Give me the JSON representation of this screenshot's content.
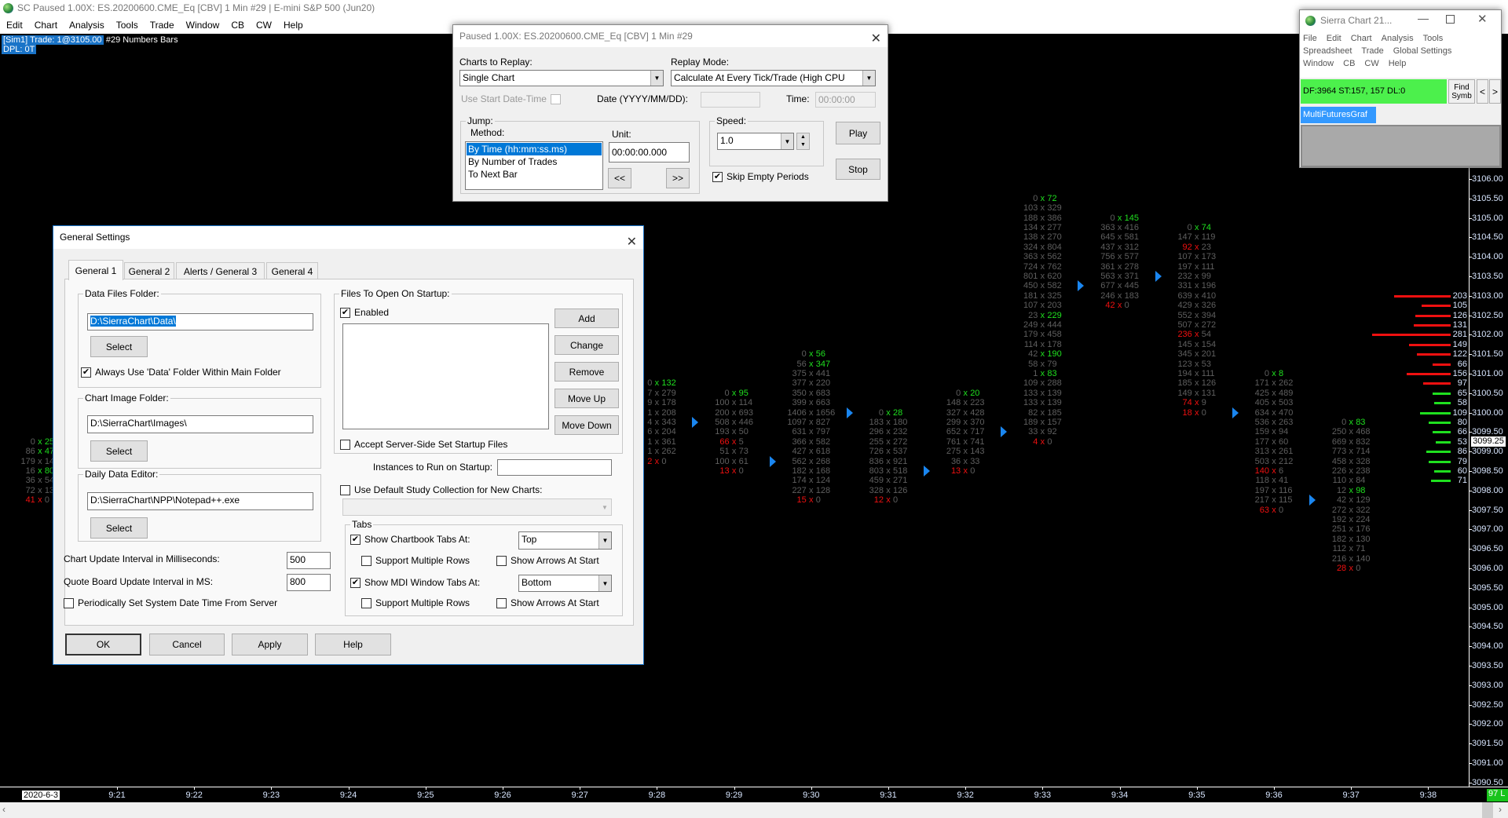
{
  "app": {
    "title": "SC Paused 1.00X: ES.20200600.CME_Eq [CBV]  1 Min   #29 | E-mini S&P 500 (Jun20)",
    "menu": [
      "Edit",
      "Chart",
      "Analysis",
      "Tools",
      "Trade",
      "Window",
      "CB",
      "CW",
      "Help"
    ]
  },
  "chart": {
    "trade_label": "[Sim1]  Trade: 1@3105.00",
    "study_label": "#29 Numbers Bars",
    "dpl_label": "DPL: 0T",
    "date_label": "2020-6-3",
    "last_label": "97 L",
    "current_price": "3099.25",
    "time_labels": [
      "9:21",
      "9:22",
      "9:23",
      "9:24",
      "9:25",
      "9:26",
      "9:27",
      "9:28",
      "9:29",
      "9:30",
      "9:31",
      "9:32",
      "9:33",
      "9:34",
      "9:35",
      "9:36",
      "9:37",
      "9:38"
    ],
    "price_labels": [
      "3106.00",
      "3105.50",
      "3105.00",
      "3104.50",
      "3104.00",
      "3103.50",
      "3103.00",
      "3102.50",
      "3102.00",
      "3101.50",
      "3101.00",
      "3100.50",
      "3100.00",
      "3099.50",
      "3099.00",
      "3098.50",
      "3098.00",
      "3097.50",
      "3097.00",
      "3096.50",
      "3096.00",
      "3095.50",
      "3095.00",
      "3094.50",
      "3094.00",
      "3093.50",
      "3093.00",
      "3092.50",
      "3092.00",
      "3091.50",
      "3091.00",
      "3090.50"
    ],
    "colors": {
      "bid_imbalance": "#f01010",
      "ask_imbalance": "#1fe01f",
      "neutral": "#5f5f5f",
      "marker": "#1a86f0"
    },
    "bars": [
      {
        "minute": 20,
        "high": 3099.25,
        "close": 3098.0,
        "rows": [
          [
            "0",
            "25",
            "a"
          ],
          [
            "86",
            "47",
            "a"
          ],
          [
            "179",
            "14",
            ""
          ],
          [
            "16",
            "80",
            "a"
          ],
          [
            "36",
            "54",
            ""
          ],
          [
            "72",
            "13",
            ""
          ],
          [
            "41",
            "0",
            "b"
          ]
        ]
      },
      {
        "minute": 28,
        "high": 3100.75,
        "close": 3099.75,
        "rows": [
          [
            "0",
            "132",
            "a"
          ],
          [
            "7",
            "279",
            ""
          ],
          [
            "9",
            "178",
            ""
          ],
          [
            "1",
            "208",
            ""
          ],
          [
            "4",
            "343",
            ""
          ],
          [
            "6",
            "204",
            ""
          ],
          [
            "1",
            "361",
            ""
          ],
          [
            "1",
            "262",
            ""
          ],
          [
            "2",
            "0",
            "b"
          ]
        ]
      },
      {
        "minute": 29,
        "high": 3100.5,
        "close": 3098.75,
        "rows": [
          [
            "0",
            "95",
            "a"
          ],
          [
            "100",
            "114",
            ""
          ],
          [
            "200",
            "693",
            ""
          ],
          [
            "508",
            "446",
            ""
          ],
          [
            "193",
            "50",
            ""
          ],
          [
            "66",
            "5",
            "b"
          ],
          [
            "51",
            "73",
            ""
          ],
          [
            "100",
            "61",
            ""
          ],
          [
            "13",
            "0",
            "b"
          ]
        ]
      },
      {
        "minute": 30,
        "high": 3101.5,
        "close": 3100.0,
        "rows": [
          [
            "0",
            "56",
            "a"
          ],
          [
            "56",
            "347",
            "a"
          ],
          [
            "375",
            "441",
            ""
          ],
          [
            "377",
            "220",
            ""
          ],
          [
            "350",
            "683",
            ""
          ],
          [
            "399",
            "663",
            ""
          ],
          [
            "1406",
            "1656",
            ""
          ],
          [
            "1097",
            "827",
            ""
          ],
          [
            "631",
            "797",
            ""
          ],
          [
            "366",
            "582",
            ""
          ],
          [
            "427",
            "618",
            ""
          ],
          [
            "562",
            "268",
            ""
          ],
          [
            "182",
            "168",
            ""
          ],
          [
            "174",
            "124",
            ""
          ],
          [
            "227",
            "128",
            ""
          ],
          [
            "15",
            "0",
            "b"
          ]
        ]
      },
      {
        "minute": 31,
        "high": 3100.0,
        "close": 3098.5,
        "rows": [
          [
            "0",
            "28",
            "a"
          ],
          [
            "183",
            "180",
            ""
          ],
          [
            "296",
            "232",
            ""
          ],
          [
            "255",
            "272",
            ""
          ],
          [
            "726",
            "537",
            ""
          ],
          [
            "836",
            "921",
            ""
          ],
          [
            "803",
            "518",
            ""
          ],
          [
            "459",
            "271",
            ""
          ],
          [
            "328",
            "126",
            ""
          ],
          [
            "12",
            "0",
            "b"
          ]
        ]
      },
      {
        "minute": 32,
        "high": 3100.5,
        "close": 3099.5,
        "rows": [
          [
            "0",
            "20",
            "a"
          ],
          [
            "148",
            "223",
            ""
          ],
          [
            "327",
            "428",
            ""
          ],
          [
            "299",
            "370",
            ""
          ],
          [
            "652",
            "717",
            ""
          ],
          [
            "761",
            "741",
            ""
          ],
          [
            "275",
            "143",
            ""
          ],
          [
            "36",
            "33",
            ""
          ],
          [
            "13",
            "0",
            "b"
          ]
        ]
      },
      {
        "minute": 33,
        "high": 3105.5,
        "close": 3103.25,
        "rows": [
          [
            "0",
            "72",
            "a"
          ],
          [
            "103",
            "329",
            ""
          ],
          [
            "188",
            "386",
            ""
          ],
          [
            "134",
            "277",
            ""
          ],
          [
            "138",
            "270",
            ""
          ],
          [
            "324",
            "804",
            ""
          ],
          [
            "363",
            "562",
            ""
          ],
          [
            "724",
            "762",
            ""
          ],
          [
            "801",
            "620",
            ""
          ],
          [
            "450",
            "582",
            ""
          ],
          [
            "181",
            "325",
            ""
          ],
          [
            "107",
            "203",
            ""
          ],
          [
            "23",
            "229",
            "a"
          ],
          [
            "249",
            "444",
            ""
          ],
          [
            "179",
            "458",
            ""
          ],
          [
            "114",
            "178",
            ""
          ],
          [
            "42",
            "190",
            "a"
          ],
          [
            "58",
            "79",
            ""
          ],
          [
            "1",
            "83",
            "a"
          ],
          [
            "109",
            "288",
            ""
          ],
          [
            "133",
            "139",
            ""
          ],
          [
            "133",
            "139",
            ""
          ],
          [
            "82",
            "185",
            ""
          ],
          [
            "189",
            "157",
            ""
          ],
          [
            "33",
            "92",
            ""
          ],
          [
            "4",
            "0",
            "b"
          ]
        ]
      },
      {
        "minute": 34,
        "high": 3105.0,
        "close": 3103.5,
        "rows": [
          [
            "0",
            "145",
            "a"
          ],
          [
            "363",
            "416",
            ""
          ],
          [
            "645",
            "581",
            ""
          ],
          [
            "437",
            "312",
            ""
          ],
          [
            "756",
            "577",
            ""
          ],
          [
            "361",
            "278",
            ""
          ],
          [
            "563",
            "371",
            ""
          ],
          [
            "677",
            "445",
            ""
          ],
          [
            "246",
            "183",
            ""
          ],
          [
            "42",
            "0",
            "b"
          ]
        ]
      },
      {
        "minute": 35,
        "high": 3104.75,
        "close": 3100.0,
        "rows": [
          [
            "0",
            "74",
            "a"
          ],
          [
            "147",
            "119",
            ""
          ],
          [
            "92",
            "23",
            "b"
          ],
          [
            "107",
            "173",
            ""
          ],
          [
            "197",
            "111",
            ""
          ],
          [
            "232",
            "99",
            ""
          ],
          [
            "331",
            "196",
            ""
          ],
          [
            "639",
            "410",
            ""
          ],
          [
            "429",
            "326",
            ""
          ],
          [
            "552",
            "394",
            ""
          ],
          [
            "507",
            "272",
            ""
          ],
          [
            "236",
            "54",
            "b"
          ],
          [
            "145",
            "154",
            ""
          ],
          [
            "345",
            "201",
            ""
          ],
          [
            "123",
            "53",
            ""
          ],
          [
            "194",
            "111",
            ""
          ],
          [
            "185",
            "126",
            ""
          ],
          [
            "149",
            "131",
            ""
          ],
          [
            "74",
            "9",
            "b"
          ],
          [
            "18",
            "0",
            "b"
          ]
        ]
      },
      {
        "minute": 36,
        "high": 3101.0,
        "close": 3097.75,
        "rows": [
          [
            "0",
            "8",
            "a"
          ],
          [
            "171",
            "262",
            ""
          ],
          [
            "425",
            "489",
            ""
          ],
          [
            "405",
            "503",
            ""
          ],
          [
            "634",
            "470",
            ""
          ],
          [
            "536",
            "263",
            ""
          ],
          [
            "159",
            "94",
            ""
          ],
          [
            "177",
            "60",
            ""
          ],
          [
            "313",
            "261",
            ""
          ],
          [
            "503",
            "212",
            ""
          ],
          [
            "140",
            "6",
            "b"
          ],
          [
            "118",
            "41",
            ""
          ],
          [
            "197",
            "116",
            ""
          ],
          [
            "217",
            "115",
            ""
          ],
          [
            "63",
            "0",
            "b"
          ]
        ]
      },
      {
        "minute": 37,
        "high": 3099.75,
        "close": null,
        "rows": [
          [
            "0",
            "83",
            "a"
          ],
          [
            "250",
            "468",
            ""
          ],
          [
            "669",
            "832",
            ""
          ],
          [
            "773",
            "714",
            ""
          ],
          [
            "458",
            "328",
            ""
          ],
          [
            "226",
            "238",
            ""
          ],
          [
            "110",
            "84",
            ""
          ],
          [
            "12",
            "98",
            "a"
          ],
          [
            "42",
            "129",
            ""
          ],
          [
            "272",
            "322",
            ""
          ],
          [
            "192",
            "224",
            ""
          ],
          [
            "251",
            "176",
            ""
          ],
          [
            "182",
            "130",
            ""
          ],
          [
            "112",
            "71",
            ""
          ],
          [
            "216",
            "140",
            ""
          ],
          [
            "28",
            "0",
            "b"
          ]
        ]
      }
    ],
    "volume_profile": {
      "top_price": 3103.0,
      "values": [
        "203",
        "105",
        "126",
        "131",
        "281",
        "149",
        "122",
        "66",
        "156",
        "97",
        "65",
        "58",
        "109",
        "80",
        "66",
        "53",
        "86",
        "79",
        "60",
        "71"
      ],
      "sides": [
        "sell",
        "sell",
        "sell",
        "sell",
        "sell",
        "sell",
        "sell",
        "sell",
        "sell",
        "sell",
        "buy",
        "buy",
        "buy",
        "buy",
        "buy",
        "buy",
        "buy",
        "buy",
        "buy",
        "buy"
      ]
    }
  },
  "replay": {
    "title": "Paused 1.00X: ES.20200600.CME_Eq [CBV]  1 Min   #29",
    "charts_label": "Charts to Replay:",
    "charts_value": "Single Chart",
    "mode_label": "Replay Mode:",
    "mode_value": "Calculate At Every Tick/Trade (High CPU",
    "use_start_label": "Use Start Date-Time",
    "date_label": "Date (YYYY/MM/DD):",
    "date_value": "",
    "time_label": "Time:",
    "time_value": "00:00:00",
    "jump_label": "Jump:",
    "method_label": "Method:",
    "methods": [
      "By Time (hh:mm:ss.ms)",
      "By Number of Trades",
      "To Next Bar"
    ],
    "unit_label": "Unit:",
    "unit_value": "00:00:00.000",
    "back_label": "<<",
    "fwd_label": ">>",
    "speed_label": "Speed:",
    "speed_value": "1.0",
    "skip_label": "Skip Empty Periods",
    "play_label": "Play",
    "stop_label": "Stop"
  },
  "general_settings": {
    "title": "General Settings",
    "tabs": [
      "General 1",
      "General 2",
      "Alerts / General 3",
      "General 4"
    ],
    "data_folder_label": "Data Files Folder:",
    "data_folder_value": "D:\\SierraChart\\Data\\",
    "select_label": "Select",
    "always_use_label": "Always Use 'Data' Folder Within Main Folder",
    "image_folder_label": "Chart Image Folder:",
    "image_folder_value": "D:\\SierraChart\\Images\\",
    "editor_label": "Daily Data Editor:",
    "editor_value": "D:\\SierraChart\\NPP\\Notepad++.exe",
    "chart_update_label": "Chart Update Interval in Milliseconds:",
    "chart_update_value": "500",
    "quote_update_label": "Quote Board Update Interval in MS:",
    "quote_update_value": "800",
    "periodic_label": "Periodically Set System Date Time From Server",
    "files_label": "Files To Open On Startup:",
    "enabled_label": "Enabled",
    "file_buttons": [
      "Add",
      "Change",
      "Remove",
      "Move Up",
      "Move Down"
    ],
    "accept_label": "Accept Server-Side Set Startup Files",
    "instances_label": "Instances to Run on Startup:",
    "instances_value": "",
    "default_study_label": "Use Default Study Collection for New Charts:",
    "tabs_group_label": "Tabs",
    "chartbook_tabs_label": "Show Chartbook Tabs At:",
    "chartbook_tabs_value": "Top",
    "mdi_tabs_label": "Show MDI Window Tabs At:",
    "mdi_tabs_value": "Bottom",
    "multi_rows_label": "Support Multiple Rows",
    "arrows_label": "Show Arrows At Start",
    "ok_label": "OK",
    "cancel_label": "Cancel",
    "apply_label": "Apply",
    "help_label": "Help"
  },
  "mini_window": {
    "title": "Sierra Chart 21...",
    "menu": [
      "File",
      "Edit",
      "Chart",
      "Analysis",
      "Tools",
      "Spreadsheet",
      "Trade",
      "Global Settings",
      "Window",
      "CB",
      "CW",
      "Help"
    ],
    "status": "DF:3964  ST:157, 157  DL:0",
    "find_label": "Find Symb",
    "prev_label": "<",
    "next_label": ">",
    "tab_label": "MultiFuturesGraf"
  }
}
